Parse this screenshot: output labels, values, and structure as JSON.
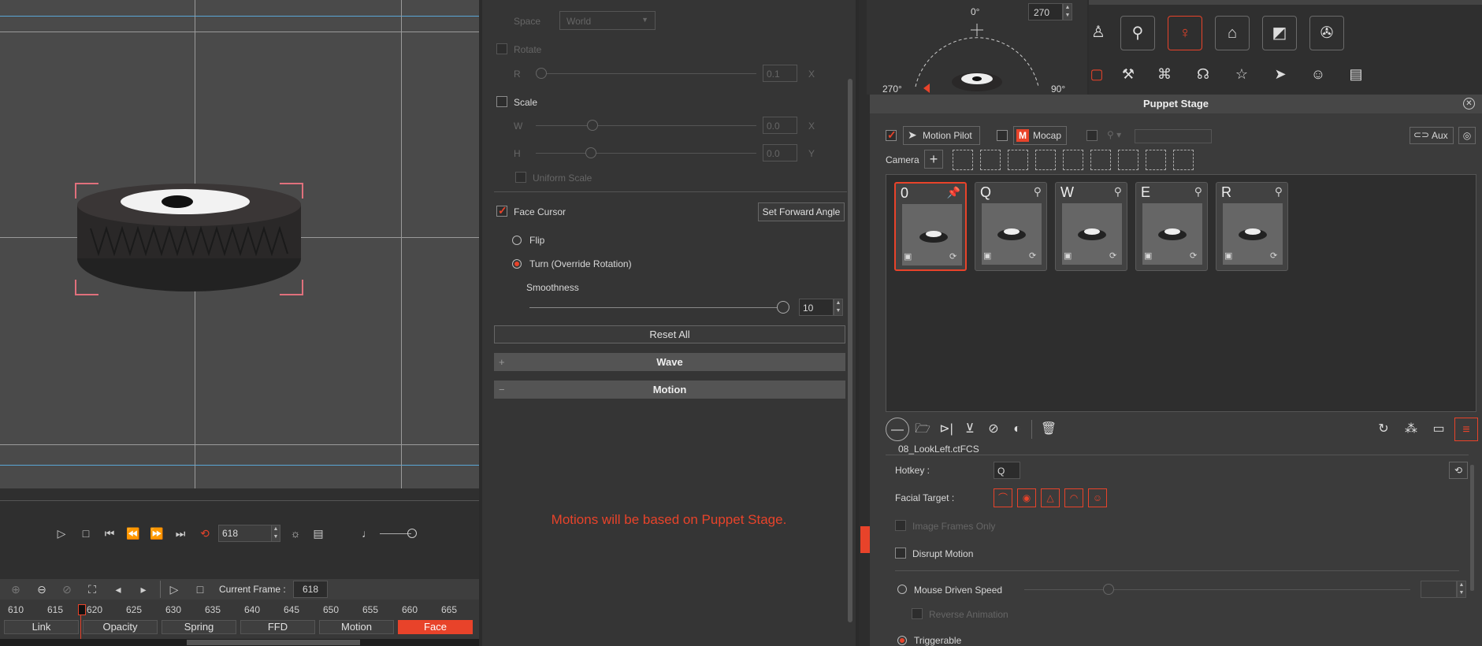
{
  "playback": {
    "frame_value": "618"
  },
  "timeline": {
    "current_frame_label": "Current Frame :",
    "current_frame_value": "618",
    "ticks": [
      "610",
      "615",
      "620",
      "625",
      "630",
      "635",
      "640",
      "645",
      "650",
      "655",
      "660",
      "665"
    ],
    "tracks": [
      "Link",
      "Opacity",
      "Spring",
      "FFD",
      "Motion",
      "Face"
    ]
  },
  "mid": {
    "space_label": "Space",
    "space_value": "World",
    "rotate_label": "Rotate",
    "r_label": "R",
    "r_value": "0.1",
    "r_axis": "X",
    "scale_label": "Scale",
    "w_label": "W",
    "w_value": "0.0",
    "w_axis": "X",
    "h_label": "H",
    "h_value": "0.0",
    "h_axis": "Y",
    "uniform_scale_label": "Uniform Scale",
    "face_cursor_label": "Face Cursor",
    "set_forward_angle_label": "Set Forward Angle",
    "flip_label": "Flip",
    "turn_label": "Turn (Override Rotation)",
    "smoothness_label": "Smoothness",
    "smoothness_value": "10",
    "reset_all_label": "Reset All",
    "wave_label": "Wave",
    "motion_label": "Motion",
    "motion_message": "Motions will be based on Puppet Stage.",
    "accent_color": "#e8432a"
  },
  "compass": {
    "top_label": "0°",
    "left_label": "270°",
    "right_label": "90°",
    "angle_value": "270"
  },
  "puppet_stage": {
    "title": "Puppet Stage",
    "motion_pilot_label": "Motion Pilot",
    "mocap_label": "Mocap",
    "aux_label": "Aux",
    "camera_label": "Camera",
    "cards": [
      {
        "key": "0"
      },
      {
        "key": "Q"
      },
      {
        "key": "W"
      },
      {
        "key": "E"
      },
      {
        "key": "R"
      }
    ],
    "file_name": "08_LookLeft.ctFCS",
    "hotkey_label": "Hotkey :",
    "hotkey_value": "Q",
    "facial_target_label": "Facial Target :",
    "image_frames_only_label": "Image Frames Only",
    "disrupt_motion_label": "Disrupt Motion",
    "mouse_driven_speed_label": "Mouse Driven Speed",
    "reverse_animation_label": "Reverse Animation",
    "triggerable_label": "Triggerable"
  }
}
